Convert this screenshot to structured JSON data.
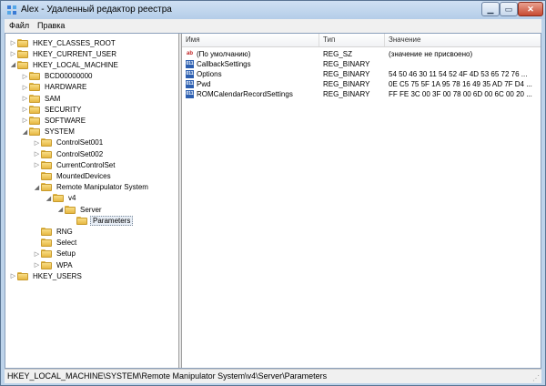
{
  "window": {
    "title": "Alex - Удаленный редактор реестра"
  },
  "menu": {
    "items": [
      "Файл",
      "Правка"
    ]
  },
  "tree": {
    "nodes": [
      {
        "label": "HKEY_CLASSES_ROOT",
        "depth": 0,
        "expander": "▷",
        "selected": false
      },
      {
        "label": "HKEY_CURRENT_USER",
        "depth": 0,
        "expander": "▷",
        "selected": false
      },
      {
        "label": "HKEY_LOCAL_MACHINE",
        "depth": 0,
        "expander": "◢",
        "selected": false
      },
      {
        "label": "BCD00000000",
        "depth": 1,
        "expander": "▷",
        "selected": false
      },
      {
        "label": "HARDWARE",
        "depth": 1,
        "expander": "▷",
        "selected": false
      },
      {
        "label": "SAM",
        "depth": 1,
        "expander": "▷",
        "selected": false
      },
      {
        "label": "SECURITY",
        "depth": 1,
        "expander": "▷",
        "selected": false
      },
      {
        "label": "SOFTWARE",
        "depth": 1,
        "expander": "▷",
        "selected": false
      },
      {
        "label": "SYSTEM",
        "depth": 1,
        "expander": "◢",
        "selected": false
      },
      {
        "label": "ControlSet001",
        "depth": 2,
        "expander": "▷",
        "selected": false
      },
      {
        "label": "ControlSet002",
        "depth": 2,
        "expander": "▷",
        "selected": false
      },
      {
        "label": "CurrentControlSet",
        "depth": 2,
        "expander": "▷",
        "selected": false
      },
      {
        "label": "MountedDevices",
        "depth": 2,
        "expander": "",
        "selected": false
      },
      {
        "label": "Remote Manipulator System",
        "depth": 2,
        "expander": "◢",
        "selected": false
      },
      {
        "label": "v4",
        "depth": 3,
        "expander": "◢",
        "selected": false
      },
      {
        "label": "Server",
        "depth": 4,
        "expander": "◢",
        "selected": false
      },
      {
        "label": "Parameters",
        "depth": 5,
        "expander": "",
        "selected": true
      },
      {
        "label": "RNG",
        "depth": 2,
        "expander": "",
        "selected": false
      },
      {
        "label": "Select",
        "depth": 2,
        "expander": "",
        "selected": false
      },
      {
        "label": "Setup",
        "depth": 2,
        "expander": "▷",
        "selected": false
      },
      {
        "label": "WPA",
        "depth": 2,
        "expander": "▷",
        "selected": false
      },
      {
        "label": "HKEY_USERS",
        "depth": 0,
        "expander": "▷",
        "selected": false
      }
    ]
  },
  "list": {
    "columns": [
      "Имя",
      "Тип",
      "Значение"
    ],
    "rows": [
      {
        "icon": "string-value-icon",
        "icon_text": "ab",
        "name": "(По умолчанию)",
        "type": "REG_SZ",
        "value": "(значение не присвоено)"
      },
      {
        "icon": "binary-value-icon",
        "icon_text": "011",
        "name": "CallbackSettings",
        "type": "REG_BINARY",
        "value": ""
      },
      {
        "icon": "binary-value-icon",
        "icon_text": "011",
        "name": "Options",
        "type": "REG_BINARY",
        "value": "54 50 46 30 11 54 52 4F 4D 53 65 72 76 ..."
      },
      {
        "icon": "binary-value-icon",
        "icon_text": "011",
        "name": "Pwd",
        "type": "REG_BINARY",
        "value": "0E C5 75 5F 1A 95 78 16 49 35 AD 7F D4 ..."
      },
      {
        "icon": "binary-value-icon",
        "icon_text": "011",
        "name": "ROMCalendarRecordSettings",
        "type": "REG_BINARY",
        "value": "FF FE 3C 00 3F 00 78 00 6D 00 6C 00 20 ..."
      }
    ]
  },
  "status": {
    "path": "HKEY_LOCAL_MACHINE\\SYSTEM\\Remote Manipulator System\\v4\\Server\\Parameters"
  },
  "colors": {
    "titlebar": "#b4cde8",
    "close_button": "#c74a32",
    "folder": "#e6b843",
    "binary_icon": "#2d5fb0",
    "string_icon": "#c02020"
  }
}
